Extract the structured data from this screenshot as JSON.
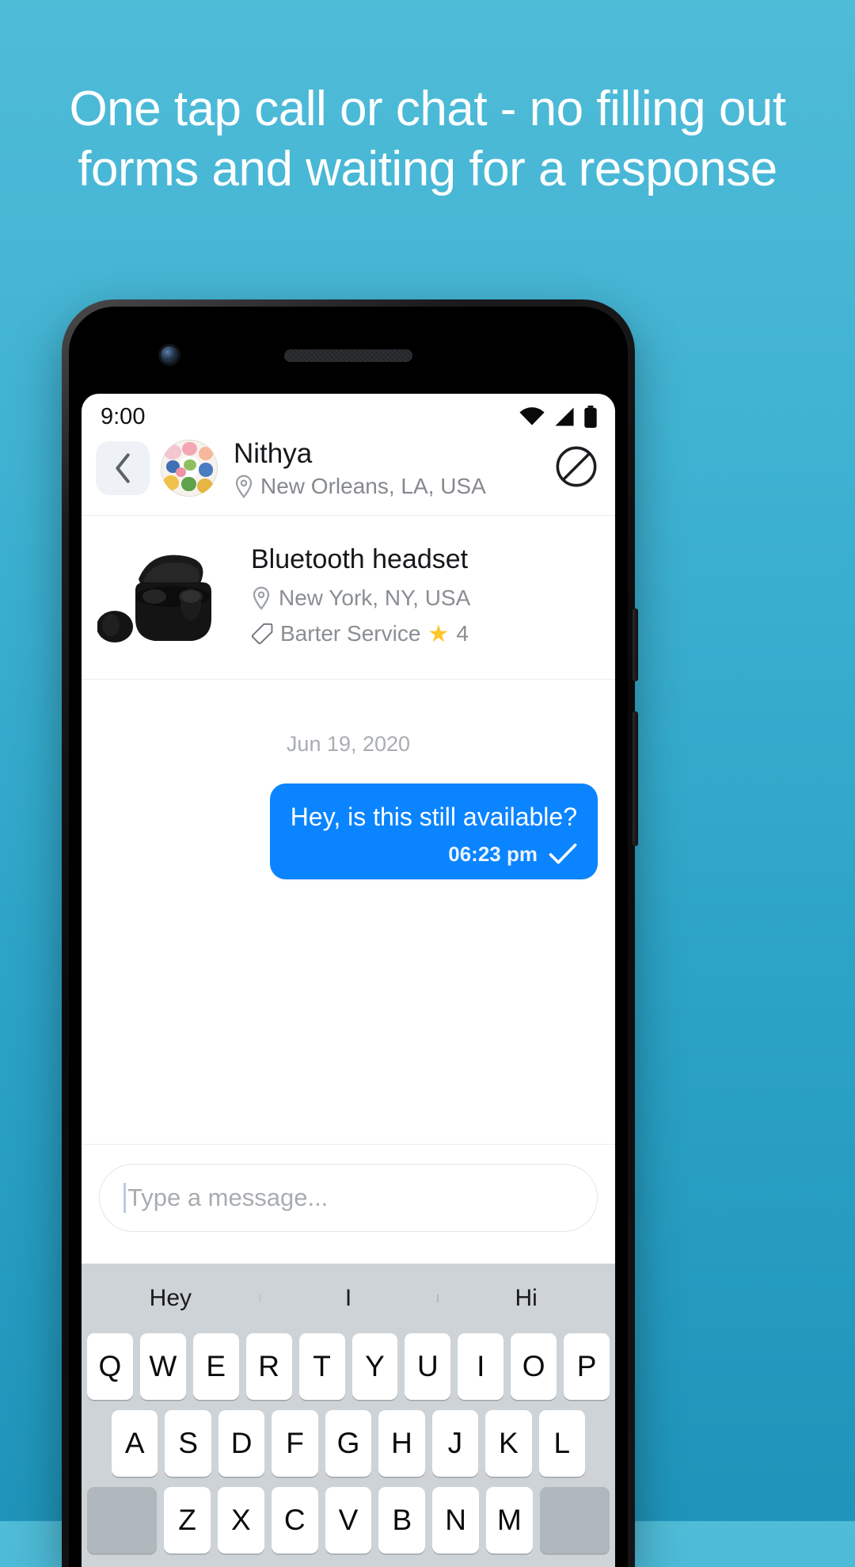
{
  "promo": {
    "headline": "One tap call or chat - no filling out forms and waiting for a response",
    "background_color": "#3fb2d2"
  },
  "phone": {
    "status_bar": {
      "time": "9:00",
      "icons": [
        "wifi-icon",
        "cellular-signal-icon",
        "battery-icon"
      ]
    },
    "chat_header": {
      "back_icon": "chevron-left-icon",
      "avatar": "floral-cake-avatar",
      "peer_name": "Nithya",
      "peer_location": "New Orleans, LA, USA",
      "location_icon": "map-pin-icon",
      "block_icon": "block-icon"
    },
    "listing": {
      "image": "bluetooth-earbuds-case-image",
      "title": "Bluetooth headset",
      "location": "New York, NY, USA",
      "location_icon": "map-pin-icon",
      "tag_icon": "price-tag-icon",
      "offer_type": "Barter Service",
      "star_icon": "star-icon",
      "rating": "4"
    },
    "conversation": {
      "date_separator": "Jun 19, 2020",
      "messages": [
        {
          "text": "Hey, is this still available?",
          "time": "06:23 pm",
          "status_icon": "check-icon",
          "outgoing": true,
          "bubble_color": "#0a84ff"
        }
      ]
    },
    "composer": {
      "placeholder": "Type a message...",
      "value": ""
    },
    "keyboard": {
      "suggestions": [
        "Hey",
        "I",
        "Hi"
      ],
      "row1": [
        "Q",
        "W",
        "E",
        "R",
        "T",
        "Y",
        "U",
        "I",
        "O",
        "P"
      ],
      "row2": [
        "A",
        "S",
        "D",
        "F",
        "G",
        "H",
        "J",
        "K",
        "L"
      ],
      "row3": [
        "Z",
        "X",
        "C",
        "V",
        "B",
        "N",
        "M"
      ]
    }
  }
}
